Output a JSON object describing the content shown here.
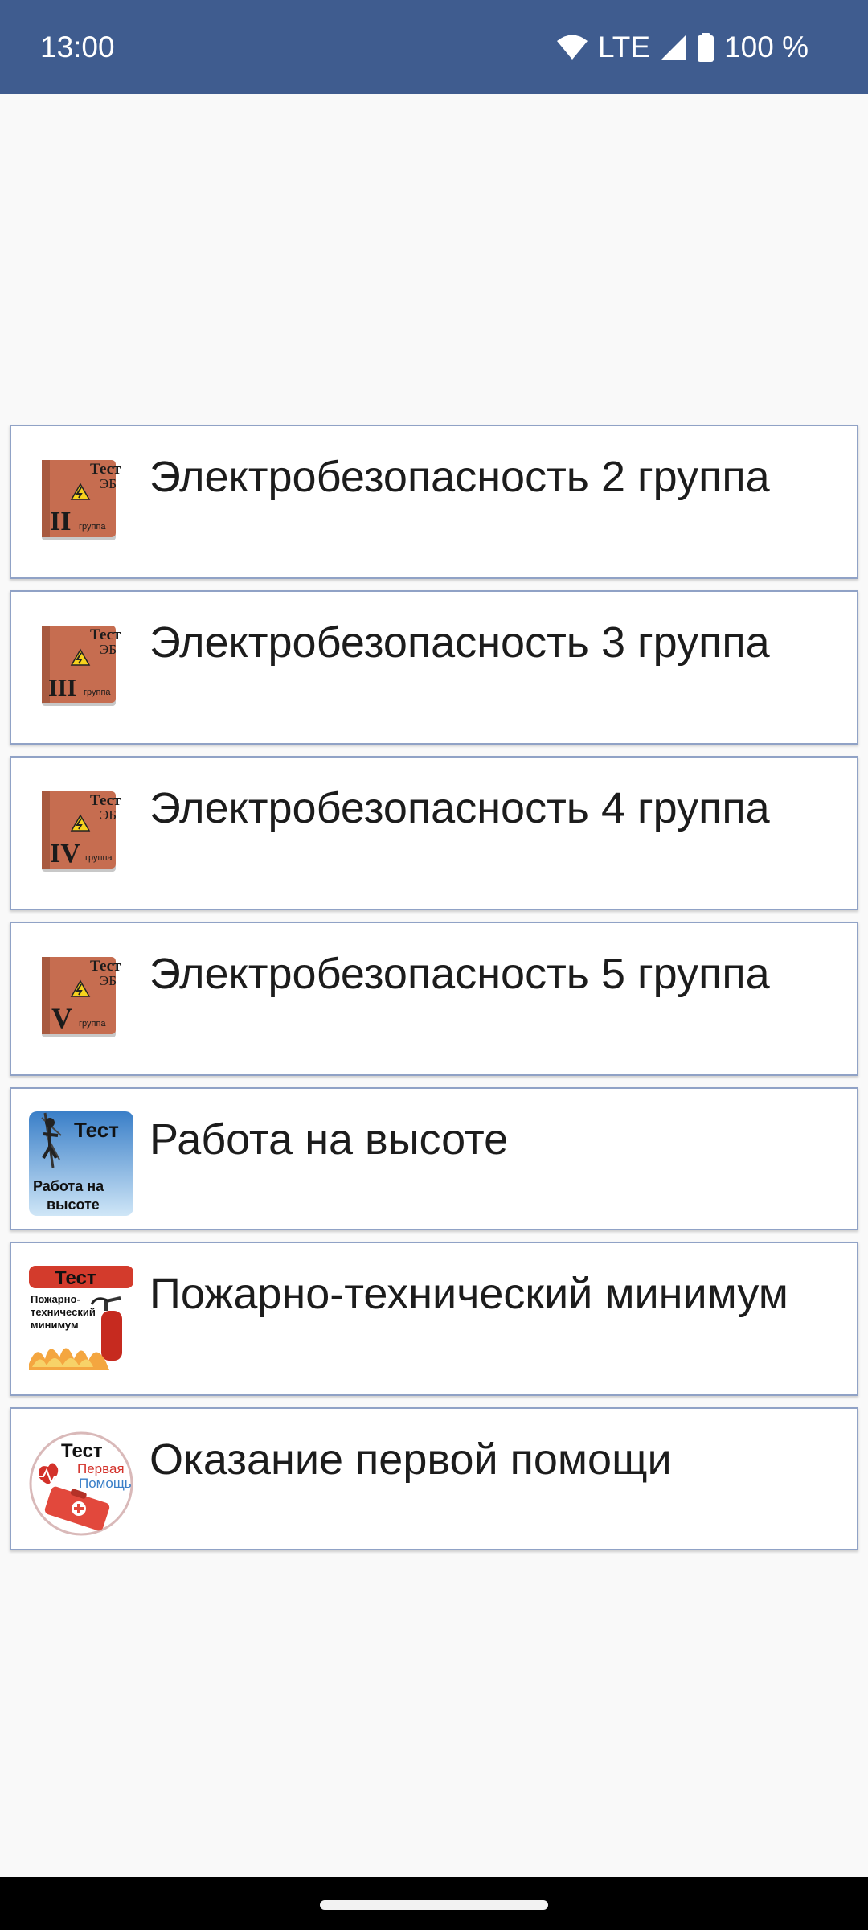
{
  "status_bar": {
    "time": "13:00",
    "network": "LTE",
    "battery": "100 %",
    "icons": [
      "wifi-icon",
      "signal-icon",
      "battery-icon"
    ]
  },
  "colors": {
    "status_bar": "#3f5c8f",
    "item_border": "#90a2c6",
    "background": "#f9f9f9"
  },
  "menu": {
    "items": [
      {
        "label": "Электробезопасность 2 группа",
        "icon": "electrical-safety-group-2-icon",
        "icon_text_top": "Тест",
        "icon_text_sub": "ЭБ",
        "icon_numeral": "II",
        "icon_caption": "группа"
      },
      {
        "label": "Электробезопасность 3 группа",
        "icon": "electrical-safety-group-3-icon",
        "icon_text_top": "Тест",
        "icon_text_sub": "ЭБ",
        "icon_numeral": "III",
        "icon_caption": "группа"
      },
      {
        "label": "Электробезопасность 4 группа",
        "icon": "electrical-safety-group-4-icon",
        "icon_text_top": "Тест",
        "icon_text_sub": "ЭБ",
        "icon_numeral": "IV",
        "icon_caption": "группа"
      },
      {
        "label": "Электробезопасность 5 группа",
        "icon": "electrical-safety-group-5-icon",
        "icon_text_top": "Тест",
        "icon_text_sub": "ЭБ",
        "icon_numeral": "V",
        "icon_caption": "группа"
      },
      {
        "label": "Работа на высоте",
        "icon": "work-at-height-icon",
        "icon_text_top": "Тест",
        "icon_text_line1": "Работа на",
        "icon_text_line2": "высоте"
      },
      {
        "label": "Пожарно-технический минимум",
        "icon": "fire-safety-icon",
        "icon_text_top": "Тест",
        "icon_text_line1": "Пожарно-",
        "icon_text_line2": "технический",
        "icon_text_line3": "минимум"
      },
      {
        "label": "Оказание первой помощи",
        "icon": "first-aid-icon",
        "icon_text_top": "Тест",
        "icon_text_line1": "Первая",
        "icon_text_line2": "Помощь"
      }
    ]
  }
}
